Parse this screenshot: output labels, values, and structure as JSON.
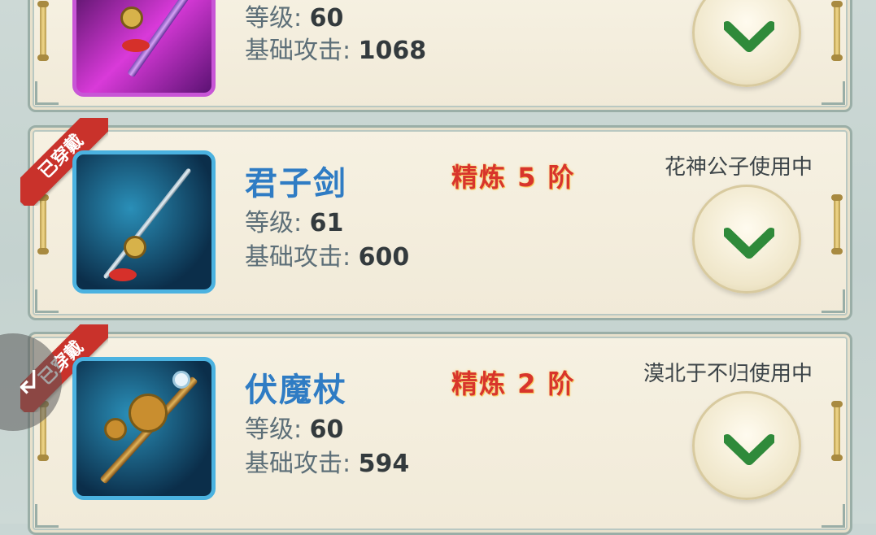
{
  "items": [
    {
      "name": "",
      "level_label": "等级:",
      "level": "60",
      "attack_label": "基础攻击:",
      "attack": "1068",
      "refine_label": "",
      "owner": "",
      "equipped_badge": ""
    },
    {
      "name": "君子剑",
      "level_label": "等级:",
      "level": "61",
      "attack_label": "基础攻击:",
      "attack": "600",
      "refine_label": "精炼 5 阶",
      "owner": "花神公子使用中",
      "equipped_badge": "已穿戴"
    },
    {
      "name": "伏魔杖",
      "level_label": "等级:",
      "level": "60",
      "attack_label": "基础攻击:",
      "attack": "594",
      "refine_label": "精炼 2 阶",
      "owner": "漠北于不归使用中",
      "equipped_badge": "已穿戴"
    }
  ],
  "colors": {
    "name_blue": "#2f7cc4",
    "badge_red": "#c9322b",
    "chevron_green": "#2f8a3a"
  },
  "icons": {
    "expand": "chevron-down-icon",
    "side_handle": "back-arrow-icon"
  }
}
